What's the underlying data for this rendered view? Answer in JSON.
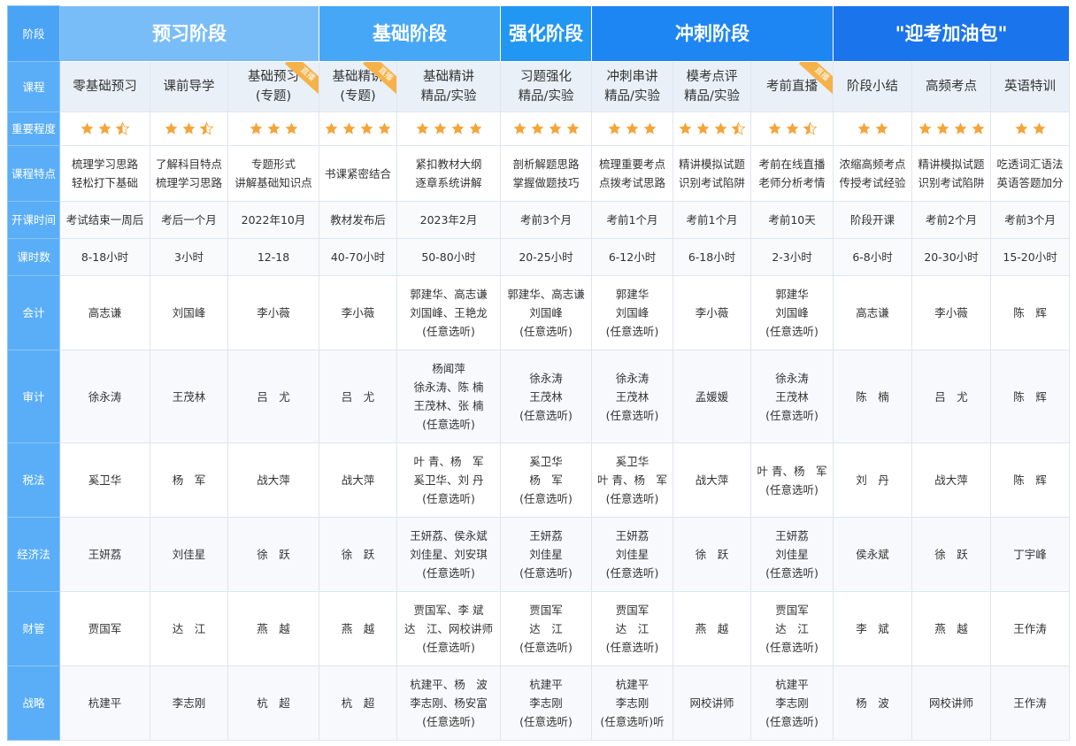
{
  "labels": {
    "stage_col": "阶段",
    "course": "课程",
    "importance": "重要程度",
    "features": "课程特点",
    "open_time": "开课时间",
    "hours": "课时数",
    "badge": "直播"
  },
  "stages": [
    "预习阶段",
    "基础阶段",
    "强化阶段",
    "冲刺阶段",
    "\"迎考加油包\""
  ],
  "courses": [
    {
      "name": "零基础预习",
      "stars": 2.5,
      "feature": "梳理学习思路\n轻松打下基础",
      "open": "考试结束一周后",
      "hours": "8-18小时",
      "badge": false
    },
    {
      "name": "课前导学",
      "stars": 2.5,
      "feature": "了解科目特点\n梳理学习思路",
      "open": "考后一个月",
      "hours": "3小时",
      "badge": false
    },
    {
      "name": "基础预习\n(专题)",
      "stars": 3,
      "feature": "专题形式\n讲解基础知识点",
      "open": "2022年10月",
      "hours": "12-18",
      "badge": true
    },
    {
      "name": "基础精讲\n(专题)",
      "stars": 4,
      "feature": "书课紧密结合",
      "open": "教材发布后",
      "hours": "40-70小时",
      "badge": true
    },
    {
      "name": "基础精讲\n精品/实验",
      "stars": 4,
      "feature": "紧扣教材大纲\n逐章系统讲解",
      "open": "2023年2月",
      "hours": "50-80小时",
      "badge": false
    },
    {
      "name": "习题强化\n精品/实验",
      "stars": 4,
      "feature": "剖析解题思路\n掌握做题技巧",
      "open": "考前3个月",
      "hours": "20-25小时",
      "badge": false
    },
    {
      "name": "冲刺串讲\n精品/实验",
      "stars": 3,
      "feature": "梳理重要考点\n点拨考试思路",
      "open": "考前1个月",
      "hours": "6-12小时",
      "badge": false
    },
    {
      "name": "模考点评\n精品/实验",
      "stars": 3.5,
      "feature": "精讲模拟试题\n识别考试陷阱",
      "open": "考前1个月",
      "hours": "6-18小时",
      "badge": false
    },
    {
      "name": "考前直播",
      "stars": 2.5,
      "feature": "考前在线直播\n老师分析考情",
      "open": "考前10天",
      "hours": "2-3小时",
      "badge": true
    },
    {
      "name": "阶段小结",
      "stars": 2,
      "feature": "浓缩高频考点\n传授考试经验",
      "open": "阶段开课",
      "hours": "6-8小时",
      "badge": false
    },
    {
      "name": "高频考点",
      "stars": 4,
      "feature": "精讲模拟试题\n识别考试陷阱",
      "open": "考前2个月",
      "hours": "20-30小时",
      "badge": false
    },
    {
      "name": "英语特训",
      "stars": 2,
      "feature": "吃透词汇语法\n英语答题加分",
      "open": "考前3个月",
      "hours": "15-20小时",
      "badge": false
    }
  ],
  "subjects": [
    {
      "name": "会计",
      "teachers": [
        "高志谦",
        "刘国峰",
        "李小薇",
        "李小薇",
        "郭建华、高志谦\n刘国峰、王艳龙\n(任意选听)",
        "郭建华、高志谦\n刘国峰\n(任意选听)",
        "郭建华\n刘国峰\n(任意选听)",
        "李小薇",
        "郭建华\n刘国峰\n(任意选听)",
        "高志谦",
        "李小薇",
        "陈　辉"
      ]
    },
    {
      "name": "审计",
      "teachers": [
        "徐永涛",
        "王茂林",
        "吕　尤",
        "吕　尤",
        "杨闻萍\n徐永涛、陈 楠\n王茂林、张 楠\n(任意选听)",
        "徐永涛\n王茂林\n(任意选听)",
        "徐永涛\n王茂林\n(任意选听)",
        "孟媛媛",
        "徐永涛\n王茂林\n(任意选听)",
        "陈　楠",
        "吕　尤",
        "陈　辉"
      ]
    },
    {
      "name": "税法",
      "teachers": [
        "奚卫华",
        "杨　军",
        "战大萍",
        "战大萍",
        "叶 青、杨　军\n奚卫华、刘 丹\n(任意选听)",
        "奚卫华\n杨　军\n(任意选听)",
        "奚卫华\n叶 青、杨　军\n(任意选听)",
        "战大萍",
        "叶 青、杨　军\n(任意选听)",
        "刘　丹",
        "战大萍",
        "陈　辉"
      ]
    },
    {
      "name": "经济法",
      "teachers": [
        "王妍荔",
        "刘佳星",
        "徐　跃",
        "徐　跃",
        "王妍荔、侯永斌\n刘佳星、刘安琪\n(任意选听)",
        "王妍荔\n刘佳星\n(任意选听)",
        "王妍荔\n刘佳星\n(任意选听)",
        "徐　跃",
        "王妍荔\n刘佳星\n(任意选听)",
        "侯永斌",
        "徐　跃",
        "丁宇峰"
      ]
    },
    {
      "name": "财管",
      "teachers": [
        "贾国军",
        "达　江",
        "燕　越",
        "燕　越",
        "贾国军、李 斌\n达　江、网校讲师\n(任意选听)",
        "贾国军\n达　江\n(任意选听)",
        "贾国军\n达　江\n(任意选听)",
        "燕　越",
        "贾国军\n达　江\n(任意选听)",
        "李　斌",
        "燕　越",
        "王作涛"
      ]
    },
    {
      "name": "战略",
      "teachers": [
        "杭建平",
        "李志刚",
        "杭　超",
        "杭　超",
        "杭建平、杨　波\n李志刚、杨安富\n(任意选听)",
        "杭建平\n李志刚\n(任意选听)",
        "杭建平\n李志刚\n(任意选听)听",
        "网校讲师",
        "杭建平\n李志刚\n(任意选听)",
        "杨　波",
        "网校讲师",
        "王作涛"
      ]
    }
  ],
  "colors": {
    "star": "#f4a43a",
    "star_empty": "#e6e6e6"
  }
}
